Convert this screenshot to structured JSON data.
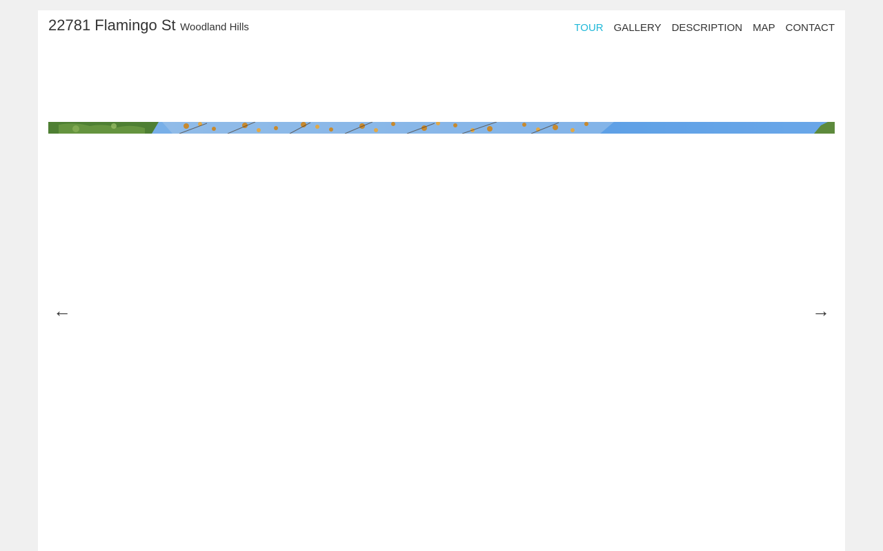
{
  "listing": {
    "address": "22781 Flamingo St",
    "city": "Woodland Hills"
  },
  "nav": {
    "items": [
      {
        "label": "TOUR",
        "active": true
      },
      {
        "label": "GALLERY",
        "active": false
      },
      {
        "label": "DESCRIPTION",
        "active": false
      },
      {
        "label": "MAP",
        "active": false
      },
      {
        "label": "CONTACT",
        "active": false
      }
    ],
    "active_color": "#1fb8d8",
    "text_color": "#333333"
  },
  "slider": {
    "prev_icon": "arrow-left-icon",
    "next_icon": "arrow-right-icon",
    "prev_glyph": "←",
    "next_glyph": "→",
    "sky_color": "#5ea0e6",
    "foliage_colors": [
      "#3f7a2c",
      "#c7892e"
    ]
  }
}
